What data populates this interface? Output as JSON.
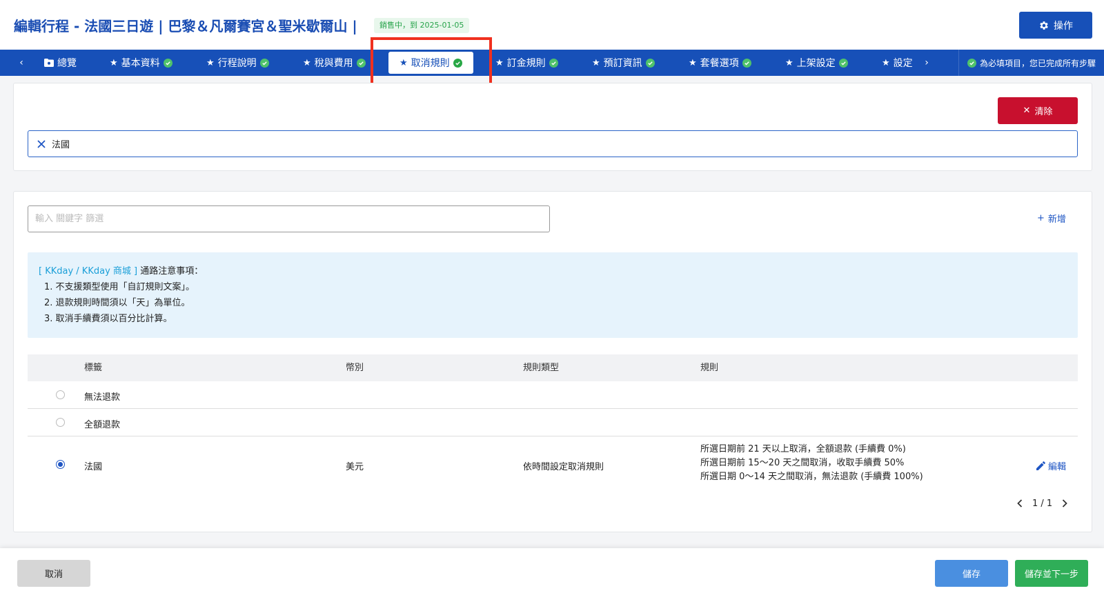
{
  "header": {
    "title": "編輯行程 - 法國三日遊 | 巴黎＆凡爾賽宮＆聖米歇爾山 |",
    "status": "銷售中，到 2025-01-05",
    "operate_label": "操作"
  },
  "tabs": {
    "prev": "‹",
    "next": "›",
    "items": [
      {
        "label": "總覽"
      },
      {
        "label": "基本資料"
      },
      {
        "label": "行程說明"
      },
      {
        "label": "稅與費用"
      },
      {
        "label": "取消規則"
      },
      {
        "label": "訂金規則"
      },
      {
        "label": "預訂資訊"
      },
      {
        "label": "套餐選項"
      },
      {
        "label": "上架設定"
      },
      {
        "label": "設定"
      }
    ],
    "note": "為必填項目，您已完成所有步驟"
  },
  "filter_panel": {
    "clear_label": "清除",
    "selected_tag": "法國"
  },
  "rules_panel": {
    "search_placeholder": "輸入 關鍵字 篩選",
    "add_label": "新增",
    "notice": {
      "channel": "[ KKday / KKday 商城 ]",
      "heading": "通路注意事項：",
      "items": [
        "1. 不支援類型使用「自訂規則文案」。",
        "2. 退款規則時間須以「天」為單位。",
        "3. 取消手續費須以百分比計算。"
      ]
    },
    "table": {
      "headers": [
        "標籤",
        "幣別",
        "規則類型",
        "規則"
      ],
      "rows": [
        {
          "label": "無法退款",
          "currency": "",
          "type": "",
          "rules": [],
          "selected": false
        },
        {
          "label": "全額退款",
          "currency": "",
          "type": "",
          "rules": [],
          "selected": false
        },
        {
          "label": "法國",
          "currency": "美元",
          "type": "依時間設定取消規則",
          "rules": [
            "所選日期前 21 天以上取消，全額退款 (手續費 0%)",
            "所選日期前 15～20 天之間取消，收取手續費 50%",
            "所選日期 0～14 天之間取消，無法退款 (手續費 100%)"
          ],
          "selected": true,
          "edit_label": "編輯"
        }
      ]
    },
    "pagination": "1 / 1"
  },
  "footer": {
    "cancel_label": "取消",
    "save_label": "儲存",
    "save_next_label": "儲存並下一步"
  },
  "colors": {
    "brand_blue": "#1750b8",
    "danger_red": "#c8102e",
    "success_green": "#2fae58",
    "highlight_red": "#f0301f"
  }
}
